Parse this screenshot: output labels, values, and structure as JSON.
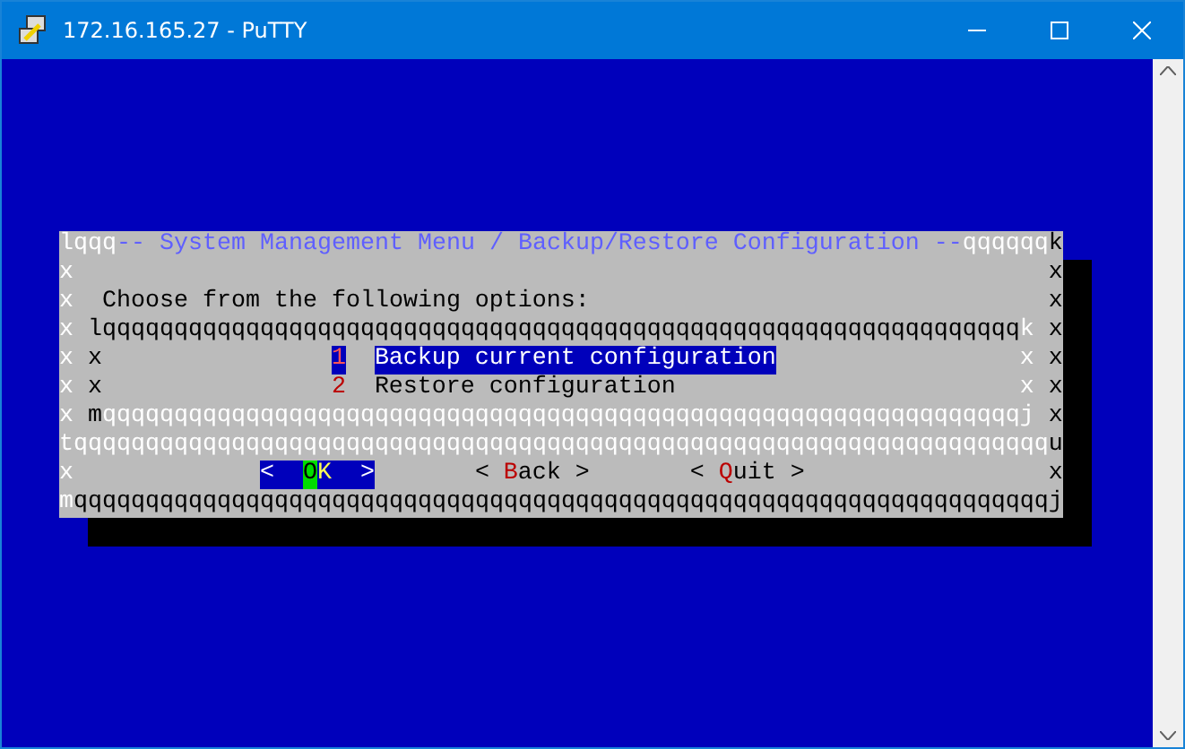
{
  "window": {
    "title": "172.16.165.27 - PuTTY"
  },
  "dialog": {
    "rows": [
      {
        "kind": "edge",
        "segments": [
          {
            "text": "lqqq",
            "color": "#ffffff"
          },
          {
            "text": "-- System Management Menu / Backup/Restore Configuration --",
            "color": "#5f5fff"
          },
          {
            "text": "qqqqqq",
            "color": "#ffffff"
          },
          {
            "text": "k",
            "color": "#000000"
          }
        ]
      },
      {
        "kind": "blank",
        "left": "x",
        "right": "x"
      },
      {
        "kind": "prompt",
        "left": "x",
        "text": "Choose from the following options:",
        "right": "x"
      },
      {
        "kind": "box_edge",
        "left": "x",
        "corner_left": "l",
        "line": "qqqqqqqqqqqqqqqqqqqqqqqqqqqqqqqqqqqqqqqqqqqqqqqqqqqqqqqqqqqqqqqq",
        "color": "#000000",
        "corner_right": "k",
        "right": "x"
      },
      {
        "kind": "item",
        "left": "x",
        "box_left": "x",
        "number": "1",
        "label": "Backup current configuration",
        "box_right": "x",
        "right": "x",
        "selected": true
      },
      {
        "kind": "item",
        "left": "x",
        "box_left": "x",
        "number": "2",
        "label": "Restore configuration",
        "box_right": "x",
        "right": "x",
        "selected": false
      },
      {
        "kind": "box_edge",
        "left": "x",
        "corner_left": "m",
        "line": "qqqqqqqqqqqqqqqqqqqqqqqqqqqqqqqqqqqqqqqqqqqqqqqqqqqqqqqqqqqqqqqq",
        "color": "#ffffff",
        "corner_right": "j",
        "right": "x"
      },
      {
        "kind": "edge",
        "segments": [
          {
            "text": "tqqqqqqqqqqqqqqqqqqqqqqqqqqqqqqqqqqqqqqqqqqqqqqqqqqqqqqqqqqqqqqqqqqqq",
            "color": "#ffffff"
          },
          {
            "text": "u",
            "color": "#000000"
          }
        ]
      },
      {
        "kind": "buttons",
        "left": "x",
        "right": "x",
        "buttons": [
          {
            "open": "<",
            "hotkey": "O",
            "rest": "K",
            "close": ">",
            "selected": true
          },
          {
            "open": "<",
            "hotkey": "B",
            "rest": "ack",
            "close": ">",
            "selected": false
          },
          {
            "open": "<",
            "hotkey": "Q",
            "rest": "uit",
            "close": ">",
            "selected": false
          }
        ]
      },
      {
        "kind": "edge",
        "segments": [
          {
            "text": "m",
            "color": "#ffffff"
          },
          {
            "text": "qqqqqqqqqqqqqqqqqqqqqqqqqqqqqqqqqqqqqqqqqqqqqqqqqqqqqqqqqqqqqqqqqqqqj",
            "color": "#000000"
          }
        ]
      }
    ]
  }
}
